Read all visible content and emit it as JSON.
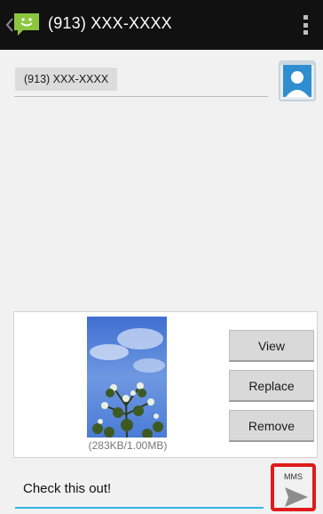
{
  "actionbar": {
    "title": "(913) XXX-XXXX",
    "app_icon": "messaging-smiley-icon",
    "overflow_icon": "overflow-menu-icon"
  },
  "recipient": {
    "chip_label": "(913) XXX-XXXX",
    "contact_icon": "contact-picker-icon"
  },
  "attachment": {
    "image": "attached-photo-thumbnail",
    "size_text": "(283KB/1.00MB)",
    "buttons": {
      "view": "View",
      "replace": "Replace",
      "remove": "Remove"
    }
  },
  "compose": {
    "text": "Check this out!",
    "send_label": "MMS",
    "send_icon": "send-icon",
    "accent_color": "#33b5e5"
  }
}
